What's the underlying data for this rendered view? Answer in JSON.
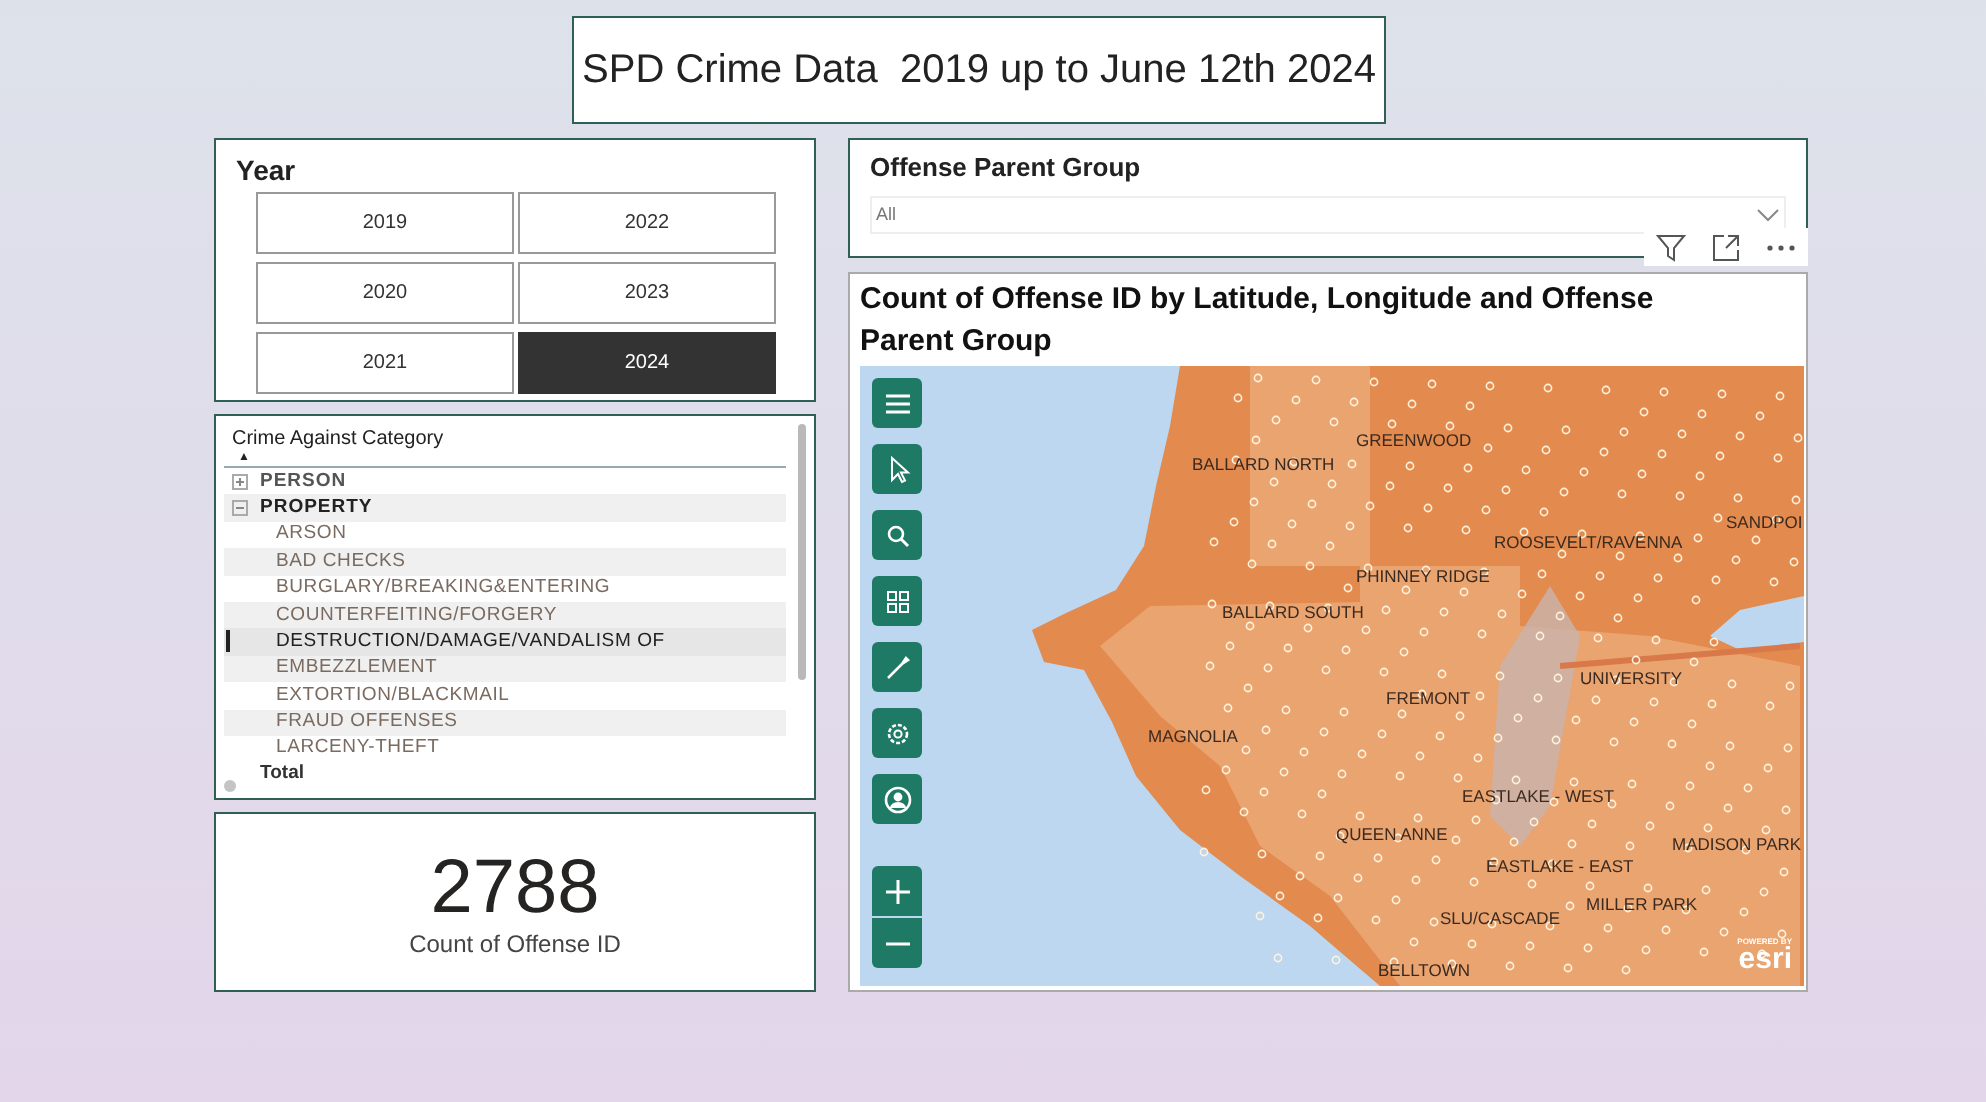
{
  "title": "SPD Crime Data  2019 up to June 12th 2024",
  "year_slicer": {
    "title": "Year",
    "years": [
      {
        "label": "2019",
        "selected": false
      },
      {
        "label": "2022",
        "selected": false
      },
      {
        "label": "2020",
        "selected": false
      },
      {
        "label": "2023",
        "selected": false
      },
      {
        "label": "2021",
        "selected": false
      },
      {
        "label": "2024",
        "selected": true
      }
    ]
  },
  "matrix": {
    "column": "Crime Against Category",
    "sort_indicator": "▲",
    "rows": [
      {
        "label": "PERSON",
        "expanded": false,
        "children": []
      },
      {
        "label": "PROPERTY",
        "expanded": true,
        "children": [
          {
            "label": "ARSON",
            "selected": false
          },
          {
            "label": "BAD CHECKS",
            "selected": false
          },
          {
            "label": "BURGLARY/BREAKING&ENTERING",
            "selected": false
          },
          {
            "label": "COUNTERFEITING/FORGERY",
            "selected": false
          },
          {
            "label": "DESTRUCTION/DAMAGE/VANDALISM OF",
            "selected": true
          },
          {
            "label": "EMBEZZLEMENT",
            "selected": false
          },
          {
            "label": "EXTORTION/BLACKMAIL",
            "selected": false
          },
          {
            "label": "FRAUD OFFENSES",
            "selected": false
          },
          {
            "label": "LARCENY-THEFT",
            "selected": false
          }
        ]
      }
    ],
    "total": "Total"
  },
  "kpi": {
    "value": "2788",
    "label": "Count of Offense ID"
  },
  "offense_slicer": {
    "title": "Offense Parent Group",
    "value": "All"
  },
  "map": {
    "title": "Count of Offense ID by Latitude, Longitude and Offense Parent Group",
    "labels": [
      "GREENWOOD",
      "BALLARD NORTH",
      "SANDPOI",
      "ROOSEVELT/RAVENNA",
      "PHINNEY RIDGE",
      "BALLARD SOUTH",
      "UNIVERSITY",
      "FREMONT",
      "MAGNOLIA",
      "EASTLAKE - WEST",
      "QUEEN ANNE",
      "MADISON PARK",
      "EASTLAKE - EAST",
      "MILLER PARK",
      "SLU/CASCADE",
      "BELLTOWN"
    ],
    "attribution_small": "POWERED BY",
    "attribution": "esri"
  }
}
